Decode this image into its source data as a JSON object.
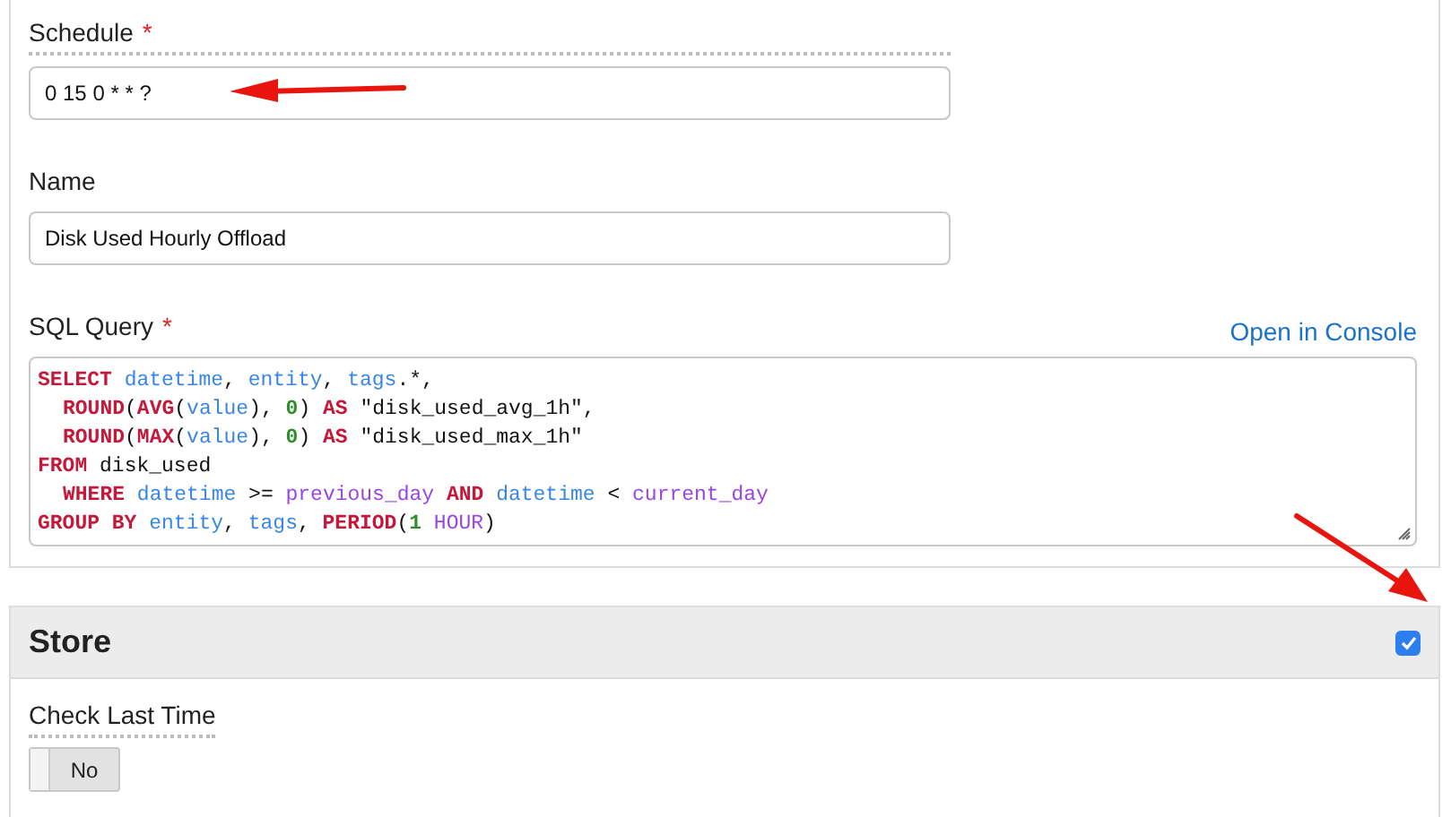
{
  "form": {
    "schedule": {
      "label": "Schedule",
      "required_mark": "*",
      "value": "0 15 0 * * ?"
    },
    "name": {
      "label": "Name",
      "value": "Disk Used Hourly Offload"
    },
    "sql_query": {
      "label": "SQL Query",
      "required_mark": "*",
      "link": "Open in Console",
      "lines": [
        {
          "indent": false,
          "tokens": [
            {
              "text": "SELECT ",
              "kind": "keyword"
            },
            {
              "text": "datetime",
              "kind": "column"
            },
            {
              "text": ", ",
              "kind": "plain"
            },
            {
              "text": "entity",
              "kind": "column"
            },
            {
              "text": ", ",
              "kind": "plain"
            },
            {
              "text": "tags",
              "kind": "column"
            },
            {
              "text": ".*,",
              "kind": "plain"
            }
          ]
        },
        {
          "indent": true,
          "tokens": [
            {
              "text": "ROUND",
              "kind": "keyword"
            },
            {
              "text": "(",
              "kind": "plain"
            },
            {
              "text": "AVG",
              "kind": "keyword"
            },
            {
              "text": "(",
              "kind": "plain"
            },
            {
              "text": "value",
              "kind": "column"
            },
            {
              "text": "), ",
              "kind": "plain"
            },
            {
              "text": "0",
              "kind": "number"
            },
            {
              "text": ") ",
              "kind": "plain"
            },
            {
              "text": "AS",
              "kind": "keyword"
            },
            {
              "text": " \"disk_used_avg_1h\",",
              "kind": "plain"
            }
          ]
        },
        {
          "indent": true,
          "tokens": [
            {
              "text": "ROUND",
              "kind": "keyword"
            },
            {
              "text": "(",
              "kind": "plain"
            },
            {
              "text": "MAX",
              "kind": "keyword"
            },
            {
              "text": "(",
              "kind": "plain"
            },
            {
              "text": "value",
              "kind": "column"
            },
            {
              "text": "), ",
              "kind": "plain"
            },
            {
              "text": "0",
              "kind": "number"
            },
            {
              "text": ") ",
              "kind": "plain"
            },
            {
              "text": "AS",
              "kind": "keyword"
            },
            {
              "text": " \"disk_used_max_1h\"",
              "kind": "plain"
            }
          ]
        },
        {
          "indent": false,
          "tokens": [
            {
              "text": "FROM",
              "kind": "keyword"
            },
            {
              "text": " disk_used",
              "kind": "plain"
            }
          ]
        },
        {
          "indent": true,
          "tokens": [
            {
              "text": "WHERE ",
              "kind": "keyword"
            },
            {
              "text": "datetime",
              "kind": "column"
            },
            {
              "text": " >= ",
              "kind": "plain"
            },
            {
              "text": "previous_day ",
              "kind": "function"
            },
            {
              "text": "AND ",
              "kind": "keyword"
            },
            {
              "text": "datetime",
              "kind": "column"
            },
            {
              "text": " < ",
              "kind": "plain"
            },
            {
              "text": "current_day",
              "kind": "function"
            }
          ]
        },
        {
          "indent": false,
          "tokens": [
            {
              "text": "GROUP BY ",
              "kind": "keyword"
            },
            {
              "text": "entity",
              "kind": "column"
            },
            {
              "text": ", ",
              "kind": "plain"
            },
            {
              "text": "tags",
              "kind": "column"
            },
            {
              "text": ", ",
              "kind": "plain"
            },
            {
              "text": "PERIOD",
              "kind": "keyword"
            },
            {
              "text": "(",
              "kind": "plain"
            },
            {
              "text": "1 ",
              "kind": "number"
            },
            {
              "text": "HOUR",
              "kind": "function"
            },
            {
              "text": ")",
              "kind": "plain"
            }
          ]
        }
      ]
    }
  },
  "store": {
    "title": "Store",
    "checked": true,
    "check_last_time": {
      "label": "Check Last Time",
      "value": "No",
      "on": false
    }
  }
}
